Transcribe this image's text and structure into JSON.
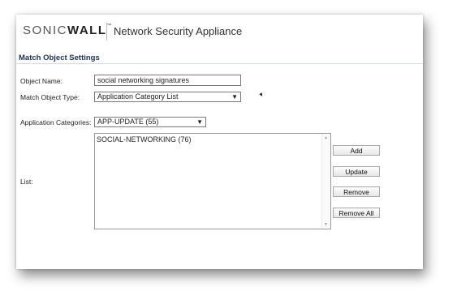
{
  "header": {
    "logo_prefix": "SONIC",
    "logo_suffix": "WALL",
    "logo_tm": "™",
    "product": "Network Security Appliance"
  },
  "section": {
    "title": "Match Object Settings"
  },
  "form": {
    "object_name_label": "Object Name:",
    "object_name_value": "social networking signatures",
    "match_type_label": "Match Object Type:",
    "match_type_value": "Application Category List",
    "app_categories_label": "Application Categories:",
    "app_categories_value": "APP-UPDATE (55)",
    "list_label": "List:",
    "list_items": [
      "SOCIAL-NETWORKING (76)"
    ]
  },
  "buttons": {
    "add": "Add",
    "update": "Update",
    "remove": "Remove",
    "remove_all": "Remove All"
  },
  "icons": {
    "dropdown": "▼",
    "scroll_up": "▲",
    "scroll_down": "▼"
  }
}
